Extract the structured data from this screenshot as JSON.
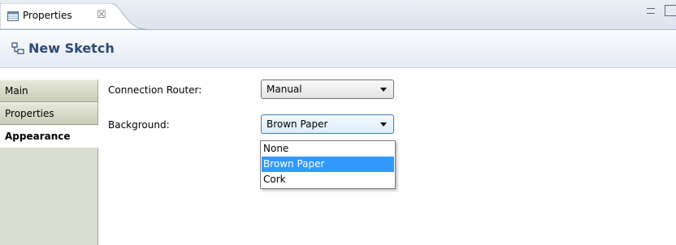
{
  "view_tab": {
    "label": "Properties",
    "close_glyph": "☒",
    "icon": "properties-table-icon"
  },
  "window_buttons": {
    "minimize_icon": "minimize-icon",
    "maximize_icon": "maximize-icon"
  },
  "header": {
    "title": "New Sketch",
    "icon": "sketch-icon"
  },
  "side_tabs": [
    {
      "label": "Main",
      "active": false
    },
    {
      "label": "Properties",
      "active": false
    },
    {
      "label": "Appearance",
      "active": true
    }
  ],
  "form": {
    "connection_router": {
      "label": "Connection Router:",
      "value": "Manual"
    },
    "background": {
      "label": "Background:",
      "value": "Brown Paper"
    }
  },
  "dropdown_options": [
    {
      "label": "None",
      "selected": false
    },
    {
      "label": "Brown Paper",
      "selected": true
    },
    {
      "label": "Cork",
      "selected": false
    }
  ],
  "colors": {
    "accent": "#3399ff",
    "title": "#2c4a73"
  }
}
